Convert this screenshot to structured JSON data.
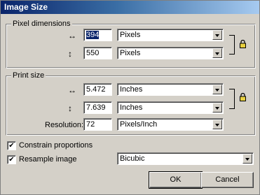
{
  "window": {
    "title": "Image Size"
  },
  "pixel_dimensions": {
    "legend": "Pixel dimensions",
    "width": {
      "icon": "↔",
      "value": "394",
      "unit": "Pixels"
    },
    "height": {
      "icon": "↕",
      "value": "550",
      "unit": "Pixels"
    }
  },
  "print_size": {
    "legend": "Print size",
    "width": {
      "icon": "↔",
      "value": "5.472",
      "unit": "Inches"
    },
    "height": {
      "icon": "↕",
      "value": "7.639",
      "unit": "Inches"
    },
    "resolution": {
      "label": "Resolution:",
      "value": "72",
      "unit": "Pixels/Inch"
    }
  },
  "options": {
    "constrain_label": "Constrain proportions",
    "constrain_checked": "✔",
    "resample_label": "Resample image",
    "resample_checked": "✔",
    "resample_method": "Bicubic"
  },
  "buttons": {
    "ok": "OK",
    "cancel": "Cancel"
  },
  "icons": {
    "lock": "lock-icon",
    "width_arrow": "horizontal-arrow-icon",
    "height_arrow": "vertical-arrow-icon",
    "dropdown": "chevron-down-icon"
  }
}
